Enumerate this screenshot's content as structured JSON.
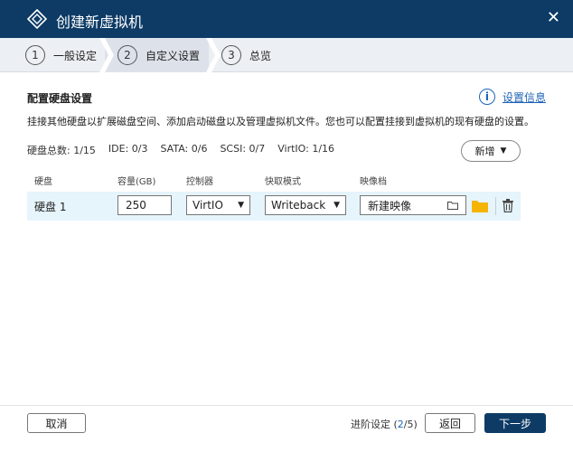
{
  "window": {
    "title": "创建新虚拟机"
  },
  "steps": [
    {
      "num": "1",
      "label": "一般设定"
    },
    {
      "num": "2",
      "label": "自定义设置"
    },
    {
      "num": "3",
      "label": "总览"
    }
  ],
  "section": {
    "title": "配置硬盘设置",
    "info_link": "设置信息",
    "description": "挂接其他硬盘以扩展磁盘空间、添加启动磁盘以及管理虚拟机文件。您也可以配置挂接到虚拟机的现有硬盘的设置。"
  },
  "stats": {
    "total": "硬盘总数: 1/15",
    "ide": "IDE: 0/3",
    "sata": "SATA: 0/6",
    "scsi": "SCSI: 0/7",
    "virtio": "VirtIO: 1/16"
  },
  "add_button": "新增",
  "table": {
    "headers": {
      "disk": "硬盘",
      "capacity": "容量(GB)",
      "controller": "控制器",
      "cache": "快取模式",
      "image": "映像档"
    },
    "rows": [
      {
        "disk": "硬盘 1",
        "capacity": "250",
        "controller": "VirtIO",
        "cache": "Writeback",
        "image": "新建映像"
      }
    ]
  },
  "footer": {
    "cancel": "取消",
    "progress_label": "进阶设定 (",
    "progress_current": "2",
    "progress_total": "/5)",
    "back": "返回",
    "next": "下一步"
  },
  "colors": {
    "titlebar": "#0d3b66",
    "accent": "#1e63b5",
    "row_highlight": "#e6f4fb",
    "folder": "#f5b400"
  }
}
